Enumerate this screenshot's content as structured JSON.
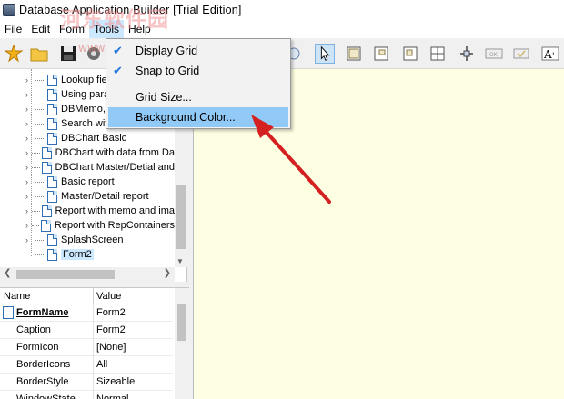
{
  "window": {
    "title": "Database Application Builder [Trial Edition]"
  },
  "watermark": {
    "text": "河东软件园",
    "url": "www.pc0359.cn"
  },
  "menubar": {
    "items": [
      {
        "label": "File"
      },
      {
        "label": "Edit"
      },
      {
        "label": "Form"
      },
      {
        "label": "Tools"
      },
      {
        "label": "Help"
      }
    ]
  },
  "dropdown": {
    "items": [
      {
        "label": "Display Grid",
        "checked": true
      },
      {
        "label": "Snap to Grid",
        "checked": true
      },
      {
        "label": "Grid Size...",
        "checked": false
      },
      {
        "label": "Background Color...",
        "checked": false,
        "highlighted": true
      }
    ]
  },
  "tree": {
    "items": [
      {
        "label": "Lookup fie"
      },
      {
        "label": "Using para"
      },
      {
        "label": "DBMemo, I"
      },
      {
        "label": "Search wit"
      },
      {
        "label": "DBChart Basic"
      },
      {
        "label": "DBChart with data from Da"
      },
      {
        "label": "DBChart Master/Detial and"
      },
      {
        "label": "Basic report"
      },
      {
        "label": "Master/Detail report"
      },
      {
        "label": "Report with memo and ima"
      },
      {
        "label": "Report with RepContainers"
      },
      {
        "label": "SplashScreen"
      },
      {
        "label": "Form2",
        "selected": true
      }
    ]
  },
  "properties": {
    "headers": {
      "name": "Name",
      "value": "Value"
    },
    "rows": [
      {
        "name": "FormName",
        "value": "Form2"
      },
      {
        "name": "Caption",
        "value": "Form2"
      },
      {
        "name": "FormIcon",
        "value": "[None]"
      },
      {
        "name": "BorderIcons",
        "value": "All"
      },
      {
        "name": "BorderStyle",
        "value": "Sizeable"
      },
      {
        "name": "WindowState",
        "value": "Normal"
      }
    ]
  },
  "colors": {
    "canvas": "#fefee2",
    "highlight": "#91c9f7",
    "arrow": "#d42020",
    "check": "#1a73d9"
  }
}
